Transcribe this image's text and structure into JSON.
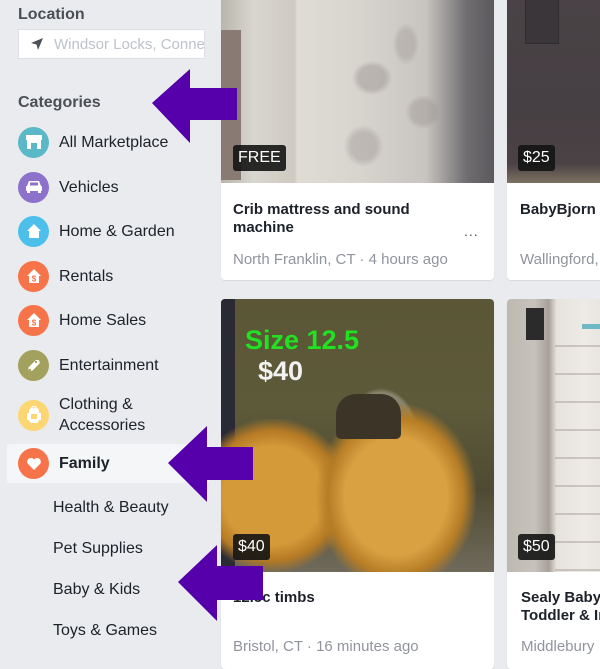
{
  "sidebar": {
    "location": {
      "title": "Location",
      "placeholder": "Windsor Locks, Connecticut",
      "icon": "navigation-arrow-icon"
    },
    "categories_title": "Categories",
    "categories": [
      {
        "label": "All Marketplace",
        "icon": "storefront-icon",
        "color": "#5bb8c6"
      },
      {
        "label": "Vehicles",
        "icon": "car-icon",
        "color": "#8c72cb"
      },
      {
        "label": "Home & Garden",
        "icon": "house-icon",
        "color": "#4cbfeb"
      },
      {
        "label": "Rentals",
        "icon": "house-dollar-icon",
        "color": "#f7734a"
      },
      {
        "label": "Home Sales",
        "icon": "house-dollar-icon",
        "color": "#f7734a"
      },
      {
        "label": "Entertainment",
        "icon": "game-controller-icon",
        "color": "#a3a15e"
      },
      {
        "label": "Clothing & Accessories",
        "icon": "backpack-icon",
        "color": "#fcd672"
      },
      {
        "label": "Family",
        "icon": "heart-icon",
        "color": "#f7734a",
        "active": true
      }
    ],
    "subcategories": [
      "Health & Beauty",
      "Pet Supplies",
      "Baby & Kids",
      "Toys & Games"
    ]
  },
  "listings": [
    {
      "price": "FREE",
      "title": "Crib mattress and sound machine",
      "location": "North Franklin, CT",
      "time": "4 hours ago",
      "meta": "North Franklin, CT · 4 hours ago",
      "more": "..."
    },
    {
      "price": "$25",
      "title": "BabyBjorn",
      "location": "Wallingford, CT",
      "meta": "Wallingford, CT"
    },
    {
      "price": "$40",
      "title": "12.5c timbs",
      "location": "Bristol, CT",
      "time": "16 minutes ago",
      "meta": "Bristol, CT · 16 minutes ago",
      "image_text": [
        "Size 12.5",
        "$40"
      ]
    },
    {
      "price": "$50",
      "title": "Sealy Baby Toddler & Infant",
      "title_line1": "Sealy Baby",
      "title_line2": "Toddler & Infant",
      "location": "Middlebury",
      "meta": "Middlebury, CT"
    }
  ],
  "annotations": {
    "arrow_color": "#5500aa"
  }
}
